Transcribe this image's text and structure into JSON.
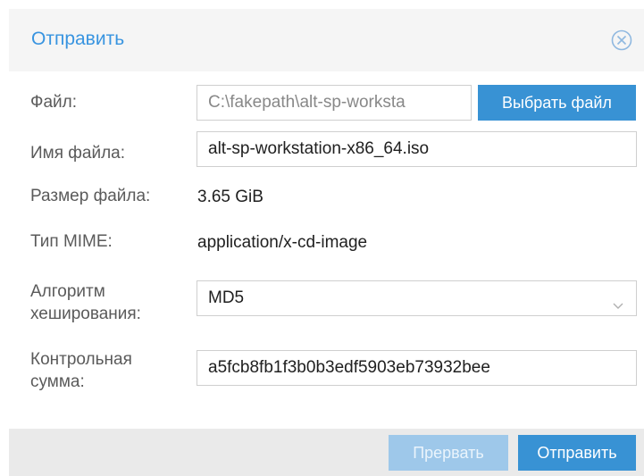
{
  "dialog": {
    "title": "Отправить"
  },
  "form": {
    "file": {
      "label": "Файл:",
      "value": "C:\\fakepath\\alt-sp-worksta",
      "choose_label": "Выбрать файл"
    },
    "filename": {
      "label": "Имя файла:",
      "value": "alt-sp-workstation-x86_64.iso"
    },
    "filesize": {
      "label": "Размер файла:",
      "value": "3.65 GiB"
    },
    "mime": {
      "label": "Тип MIME:",
      "value": "application/x-cd-image"
    },
    "hash_algorithm": {
      "label_line1": "Алгоритм",
      "label_line2": "хеширования:",
      "value": "MD5"
    },
    "checksum": {
      "label_line1": "Контрольная",
      "label_line2": "сумма:",
      "value": "a5fcb8fb1f3b0b3edf5903eb73932bee"
    }
  },
  "footer": {
    "abort_label": "Прервать",
    "submit_label": "Отправить"
  },
  "colors": {
    "accent": "#3894e0",
    "primary_button": "#3892d4",
    "disabled_button": "#9ec8ea",
    "footer_bg": "#eaeaea",
    "header_bg": "#f5f5f5"
  },
  "icons": {
    "close": "close-circle-icon",
    "dropdown": "chevron-down-icon"
  }
}
